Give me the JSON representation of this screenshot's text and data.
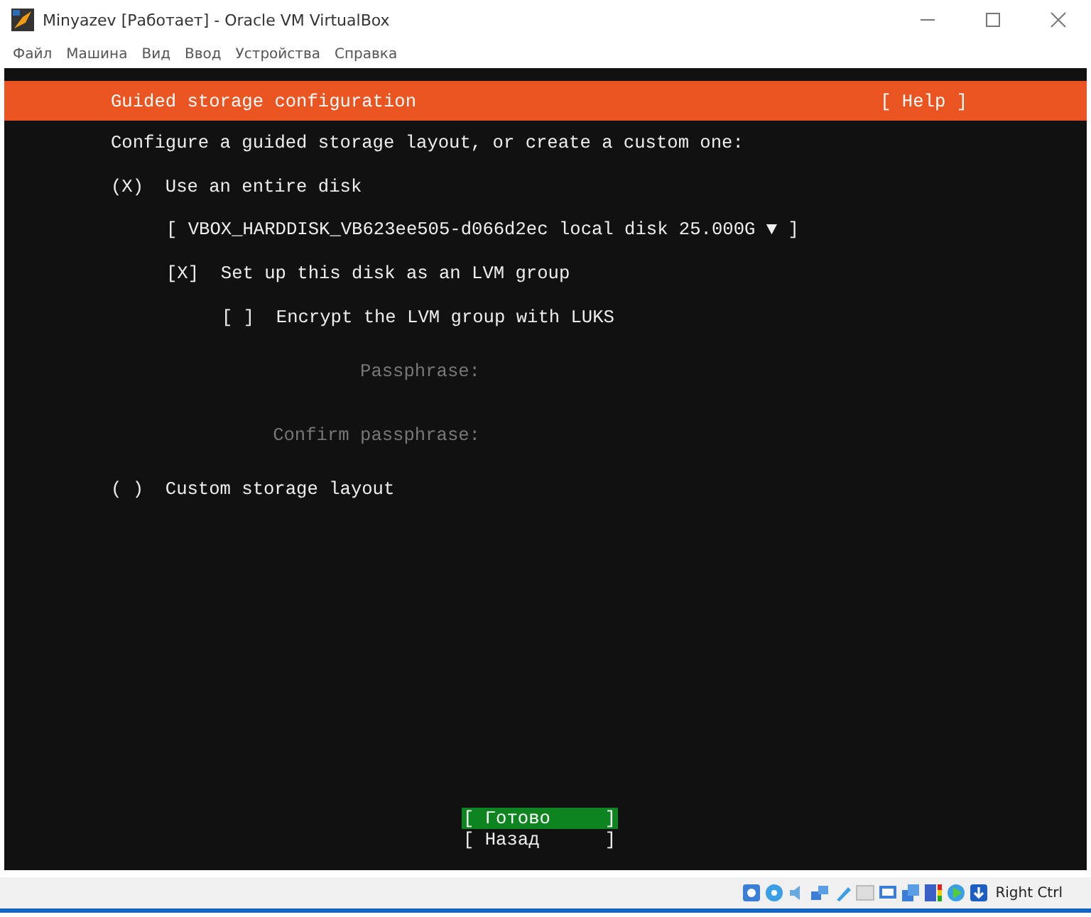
{
  "window": {
    "title": "Minyazev [Работает] - Oracle VM VirtualBox"
  },
  "menu": [
    "Файл",
    "Машина",
    "Вид",
    "Ввод",
    "Устройства",
    "Справка"
  ],
  "installer": {
    "header": {
      "title": "Guided storage configuration",
      "help": "[ Help ]"
    },
    "intro": "Configure a guided storage layout, or create a custom one:",
    "options": [
      {
        "mark": "(X)",
        "label": "Use an entire disk",
        "disk": "[ VBOX_HARDDISK_VB623ee505-d066d2ec local disk 25.000G ▼ ]",
        "lvm": {
          "mark": "[X]",
          "label": "Set up this disk as an LVM group"
        },
        "encrypt": {
          "mark": "[ ]",
          "label": "Encrypt the LVM group with LUKS"
        },
        "fields": [
          {
            "label": "Passphrase:",
            "disabled": true
          },
          {
            "label": "Confirm passphrase:",
            "disabled": true
          }
        ]
      },
      {
        "mark": "( )",
        "label": "Custom storage layout"
      }
    ],
    "buttons": [
      {
        "label": "[ Готово     ]",
        "selected": true
      },
      {
        "label": "[ Назад      ]",
        "selected": false
      }
    ]
  },
  "status_bar": {
    "host_key": "Right Ctrl"
  }
}
